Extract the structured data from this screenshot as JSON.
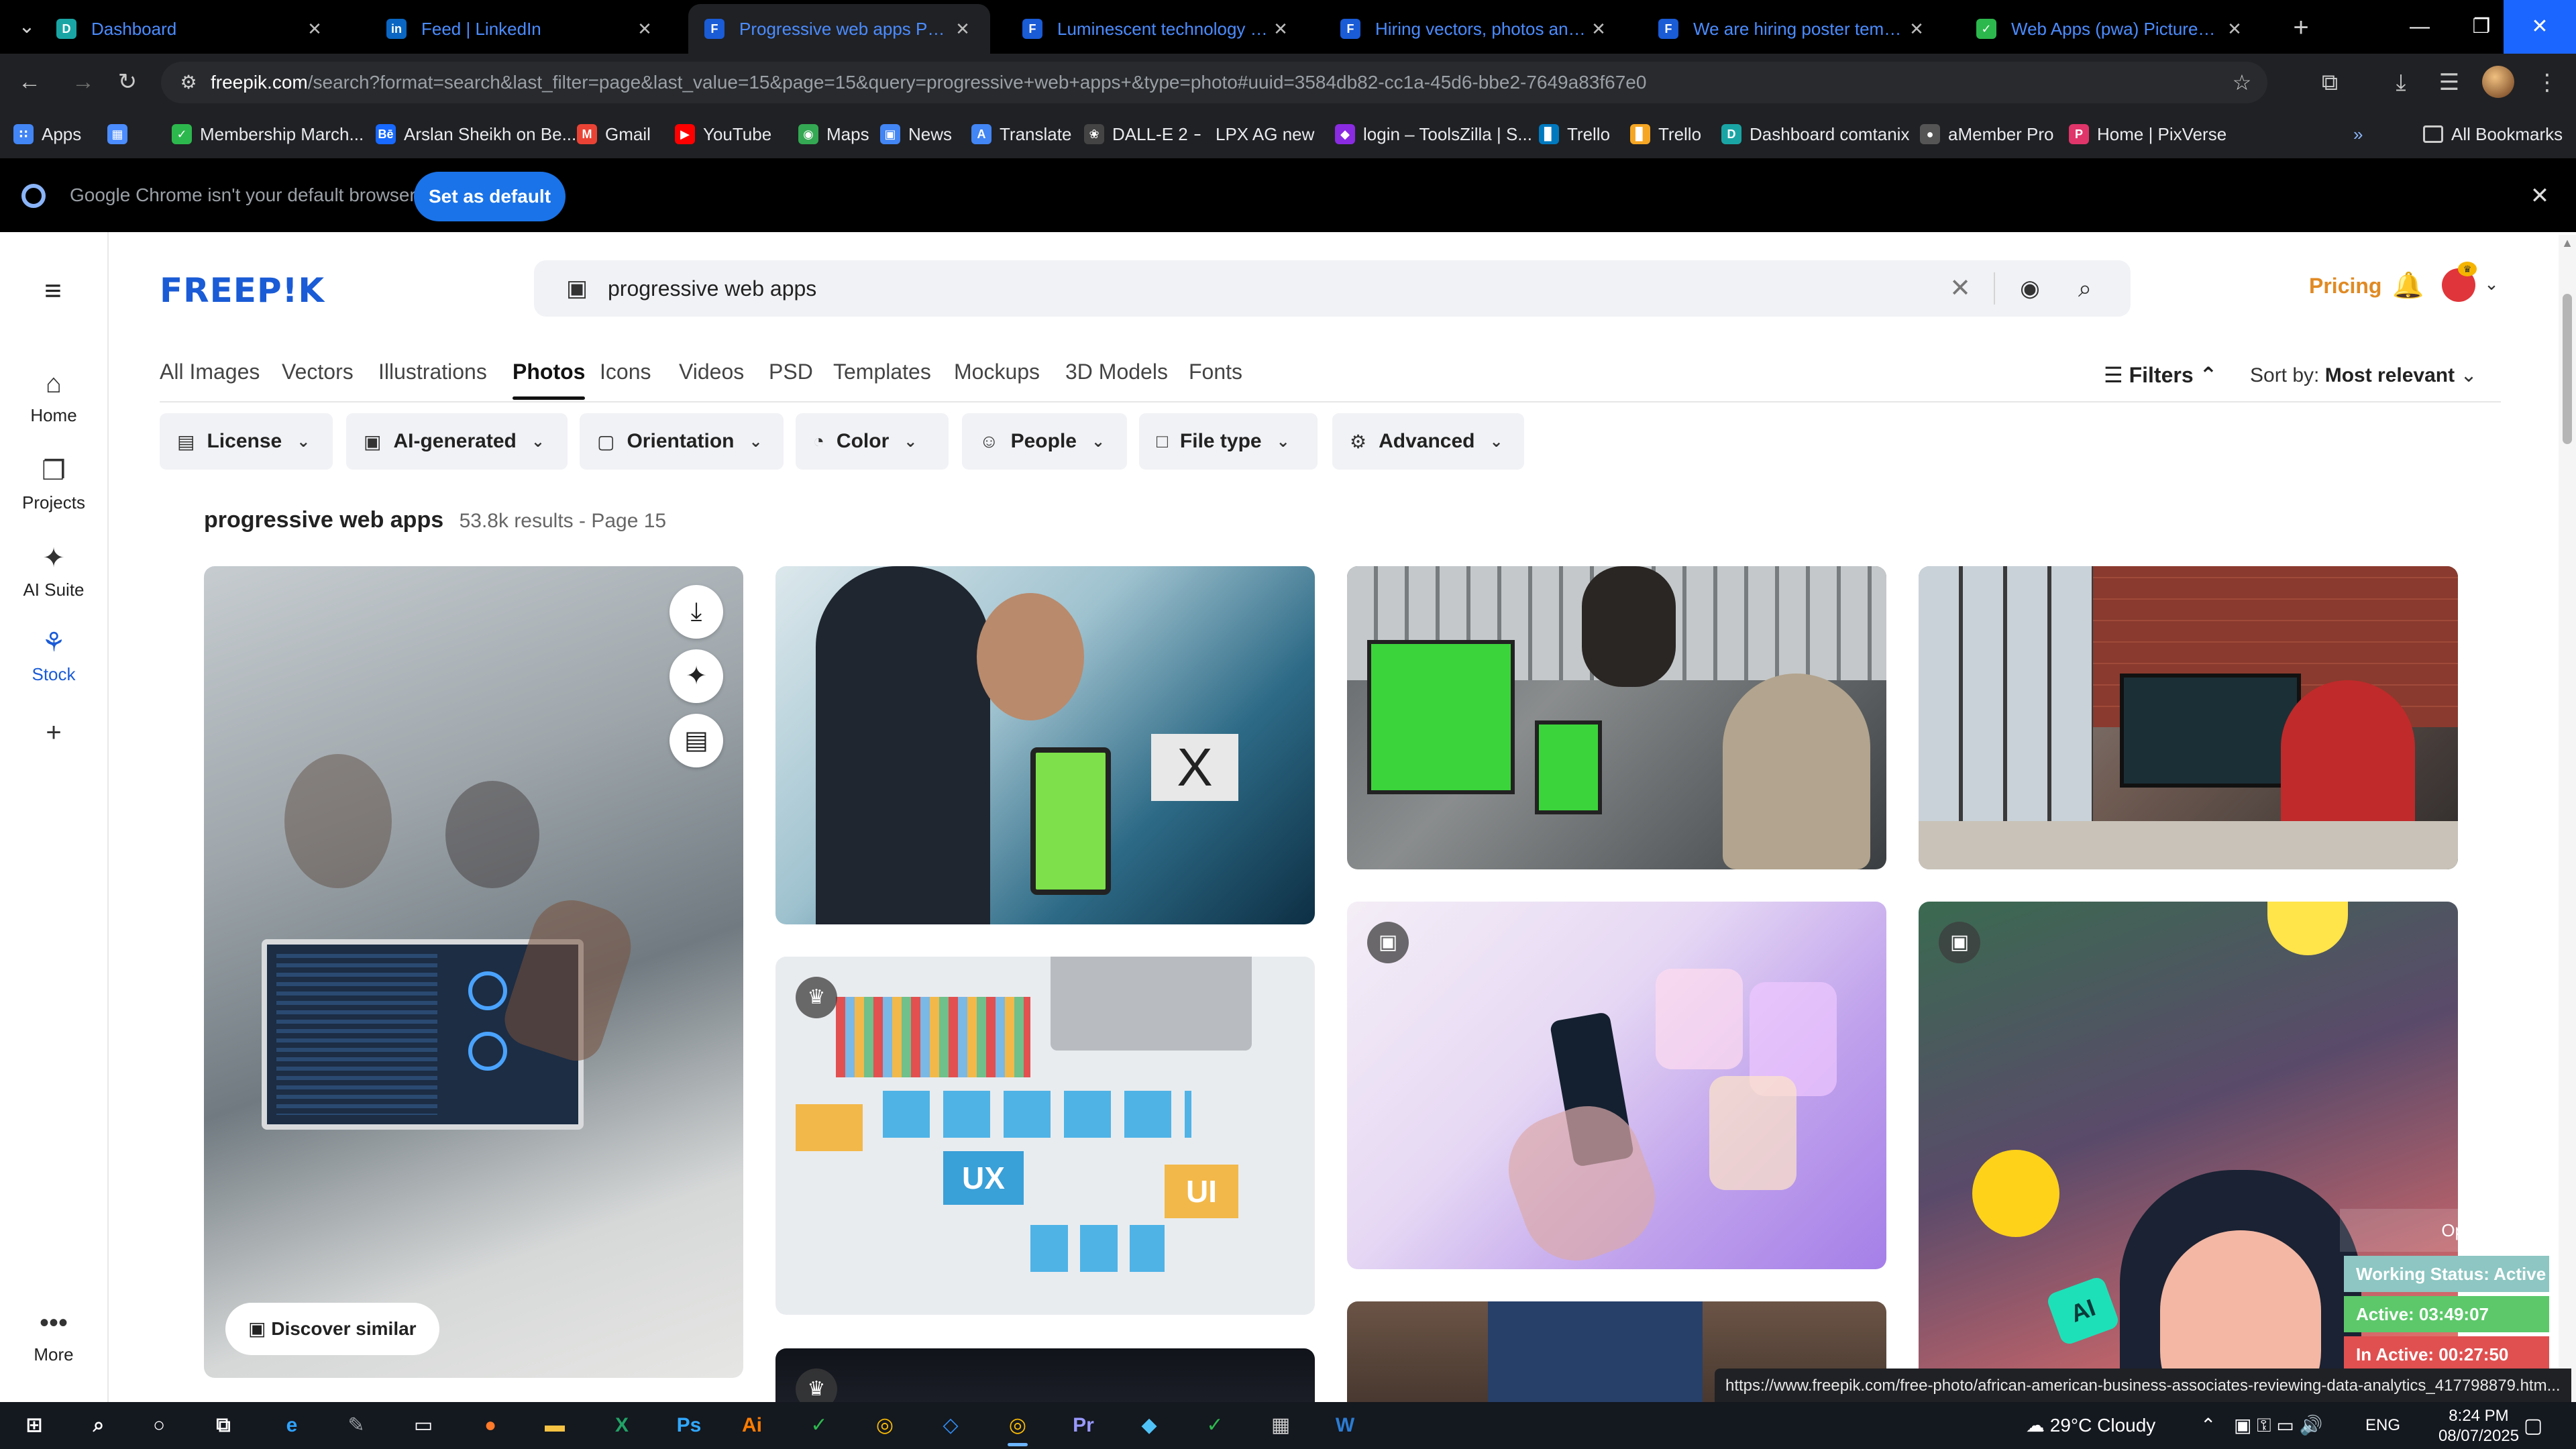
{
  "browser": {
    "tabs": [
      {
        "label": "Dashboard",
        "favicon": "D",
        "favicon_color": "#1aa5a5"
      },
      {
        "label": "Feed | LinkedIn",
        "favicon": "in",
        "favicon_color": "#0a66c2"
      },
      {
        "label": "Progressive web apps Photos | ...",
        "favicon": "F",
        "favicon_color": "#1a5bd6",
        "active": true
      },
      {
        "label": "Luminescent technology and a...",
        "favicon": "F",
        "favicon_color": "#1a5bd6"
      },
      {
        "label": "Hiring vectors, photos and PSD...",
        "favicon": "F",
        "favicon_color": "#1a5bd6"
      },
      {
        "label": "We are hiring poster template...",
        "favicon": "F",
        "favicon_color": "#1a5bd6"
      },
      {
        "label": "Web Apps (pwa) Pictures, Imag...",
        "favicon": "✓",
        "favicon_color": "#2db84d"
      }
    ],
    "url_host": "freepik.com",
    "url_path": "/search?format=search&last_filter=page&last_value=15&page=15&query=progressive+web+apps+&type=photo#uuid=3584db82-cc1a-45d6-bbe2-7649a83f67e0",
    "bookmarks": [
      {
        "label": "Apps",
        "icon_color": "#4285f4",
        "glyph": "∷"
      },
      {
        "label": "",
        "icon_color": "#4b8cff",
        "glyph": "▦"
      },
      {
        "label": "Membership March...",
        "icon_color": "#2db84d",
        "glyph": "✓"
      },
      {
        "label": "Arslan Sheikh on Be...",
        "icon_color": "#1769ff",
        "glyph": "Bē"
      },
      {
        "label": "Gmail",
        "icon_color": "#ea4335",
        "glyph": "M"
      },
      {
        "label": "YouTube",
        "icon_color": "#ff0000",
        "glyph": "▶"
      },
      {
        "label": "Maps",
        "icon_color": "#34a853",
        "glyph": "◉"
      },
      {
        "label": "News",
        "icon_color": "#4285f4",
        "glyph": "▣"
      },
      {
        "label": "Translate",
        "icon_color": "#4285f4",
        "glyph": "A"
      },
      {
        "label": "DALL-E 2",
        "icon_color": "#444444",
        "glyph": "❀"
      },
      {
        "label": "LPX AG new",
        "icon_color": "#202124",
        "glyph": "–"
      },
      {
        "label": "login – ToolsZilla | S...",
        "icon_color": "#8a2be2",
        "glyph": "◆"
      },
      {
        "label": "Trello",
        "icon_color": "#0079bf",
        "glyph": "▊"
      },
      {
        "label": "Trello",
        "icon_color": "#f5a623",
        "glyph": "▊"
      },
      {
        "label": "Dashboard comtanix",
        "icon_color": "#1aa5a5",
        "glyph": "D"
      },
      {
        "label": "aMember Pro",
        "icon_color": "#555555",
        "glyph": "●"
      },
      {
        "label": "Home | PixVerse",
        "icon_color": "#e0356a",
        "glyph": "P"
      }
    ],
    "all_bookmarks_label": "All Bookmarks",
    "infobar_message": "Google Chrome isn't your default browser",
    "infobar_button": "Set as default"
  },
  "rail": [
    {
      "label": "Home",
      "icon": "home-icon",
      "glyph": "⌂"
    },
    {
      "label": "Projects",
      "icon": "projects-icon",
      "glyph": "❐"
    },
    {
      "label": "AI Suite",
      "icon": "ai-suite-icon",
      "glyph": "✦"
    },
    {
      "label": "Stock",
      "icon": "stock-icon",
      "glyph": "⚘",
      "active": true
    },
    {
      "label": "",
      "icon": "plus-icon",
      "glyph": "+"
    },
    {
      "label": "More",
      "icon": "more-icon",
      "glyph": "•••"
    }
  ],
  "header": {
    "logo": "FREEP!K",
    "search_query": "progressive web apps",
    "pricing": "Pricing"
  },
  "type_tabs": [
    "All Images",
    "Vectors",
    "Illustrations",
    "Photos",
    "Icons",
    "Videos",
    "PSD",
    "Templates",
    "Mockups",
    "3D Models",
    "Fonts"
  ],
  "active_type_tab": "Photos",
  "filters_label": "Filters",
  "sort": {
    "label": "Sort by:",
    "value": "Most relevant"
  },
  "chips": [
    {
      "label": "License",
      "glyph": "▤"
    },
    {
      "label": "AI-generated",
      "glyph": "▣"
    },
    {
      "label": "Orientation",
      "glyph": "▢"
    },
    {
      "label": "Color",
      "glyph": "◔"
    },
    {
      "label": "People",
      "glyph": "☺"
    },
    {
      "label": "File type",
      "glyph": "□"
    },
    {
      "label": "Advanced",
      "glyph": "⚙"
    }
  ],
  "results": {
    "query": "progressive web apps",
    "summary": "53.8k results - Page 15"
  },
  "discover_similar": "Discover similar",
  "tracker": {
    "open_app": "Open App ↗",
    "status": "Working Status: Active",
    "active": "Active: 03:49:07",
    "inactive": "In Active: 00:27:50"
  },
  "status_url": "https://www.freepik.com/free-photo/african-american-business-associates-reviewing-data-analytics_417798879.htm...",
  "taskbar": {
    "weather": "29°C  Cloudy",
    "lang": "ENG",
    "time": "8:24 PM",
    "date": "08/07/2025",
    "notif_count": "1"
  }
}
